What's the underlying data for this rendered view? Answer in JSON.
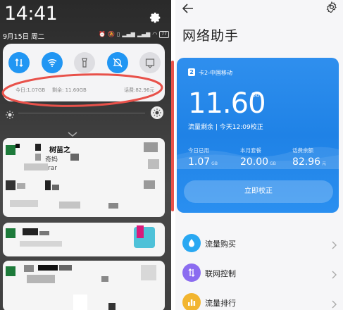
{
  "shade": {
    "time": "14:41",
    "date": "9月15日 周二",
    "status_icons": [
      "alarm-icon",
      "mute-icon",
      "vibrate-icon",
      "signal-icon",
      "signal-icon",
      "wifi-icon"
    ],
    "battery": "77",
    "quick_settings": [
      {
        "icon": "data-toggle-icon",
        "state": "on"
      },
      {
        "icon": "wifi-icon",
        "state": "on"
      },
      {
        "icon": "flashlight-icon",
        "state": "off"
      },
      {
        "icon": "mute-bell-icon",
        "state": "on"
      },
      {
        "icon": "screenshot-icon",
        "state": "off"
      }
    ],
    "data_usage": {
      "today": "今日:1.07GB",
      "remaining": "剩余: 11.60GB",
      "balance": "话费:82.96元"
    },
    "notifications": [
      {
        "title": "树苗之",
        "line1": "奇妈",
        "line2": "rar"
      }
    ]
  },
  "app": {
    "title": "网络助手",
    "card": {
      "sim_badge": "2",
      "sim_label": "卡2-中国移动",
      "remaining_value": "11.60",
      "remaining_unit": "GB",
      "remaining_label": "流量剩余 | 今天12:09校正",
      "stats": [
        {
          "label": "今日已用",
          "value": "1.07",
          "unit": "GB"
        },
        {
          "label": "本月套餐",
          "value": "20.00",
          "unit": "GB"
        },
        {
          "label": "话费余额",
          "value": "82.96",
          "unit": "元"
        }
      ],
      "calibrate_button": "立即校正"
    },
    "menu": [
      {
        "label": "流量购买",
        "icon": "droplet-icon",
        "color": "#29a8f2"
      },
      {
        "label": "联网控制",
        "icon": "updown-arrows-icon",
        "color": "#8b6cf0"
      },
      {
        "label": "流量排行",
        "icon": "bar-chart-icon",
        "color": "#f2b530"
      }
    ]
  },
  "colors": {
    "accent_blue": "#2196f3",
    "card_blue": "#2387ea",
    "annotation_red": "#e8514a"
  }
}
